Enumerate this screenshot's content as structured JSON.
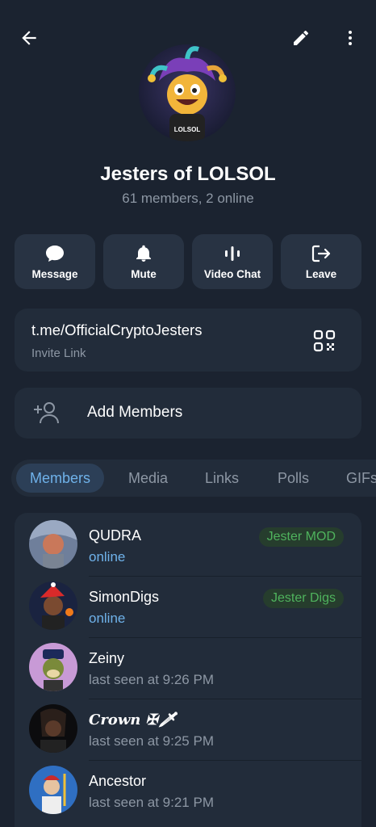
{
  "header": {
    "back_icon": "arrow-left-icon",
    "edit_icon": "pencil-icon",
    "more_icon": "more-vert-icon"
  },
  "group": {
    "name": "Jesters of LOLSOL",
    "status": "61 members, 2 online",
    "avatar_text": "LOLSOL"
  },
  "actions": [
    {
      "label": "Message",
      "icon": "chat-bubble-icon"
    },
    {
      "label": "Mute",
      "icon": "bell-icon"
    },
    {
      "label": "Video Chat",
      "icon": "voice-chat-icon"
    },
    {
      "label": "Leave",
      "icon": "leave-icon"
    }
  ],
  "invite": {
    "link": "t.me/OfficialCryptoJesters",
    "caption": "Invite Link",
    "qr_icon": "qr-code-icon"
  },
  "add_members": {
    "label": "Add Members",
    "icon": "add-person-icon"
  },
  "tabs": [
    {
      "label": "Members",
      "active": true
    },
    {
      "label": "Media"
    },
    {
      "label": "Links"
    },
    {
      "label": "Polls"
    },
    {
      "label": "GIFs"
    }
  ],
  "members": [
    {
      "name": "QUDRA",
      "status": "online",
      "online": true,
      "badge": "Jester MOD"
    },
    {
      "name": "SimonDigs",
      "status": "online",
      "online": true,
      "badge": "Jester Digs"
    },
    {
      "name": "Zeiny",
      "status": "last seen at 9:26 PM"
    },
    {
      "name": "Crown ✠🗡",
      "status": "last seen at 9:25 PM"
    },
    {
      "name": "Ancestor",
      "status": "last seen at 9:21 PM"
    }
  ],
  "colors": {
    "background": "#1b2330",
    "card": "#222c3a",
    "accent": "#6fb2ea",
    "badge_green": "#4fb35d"
  }
}
